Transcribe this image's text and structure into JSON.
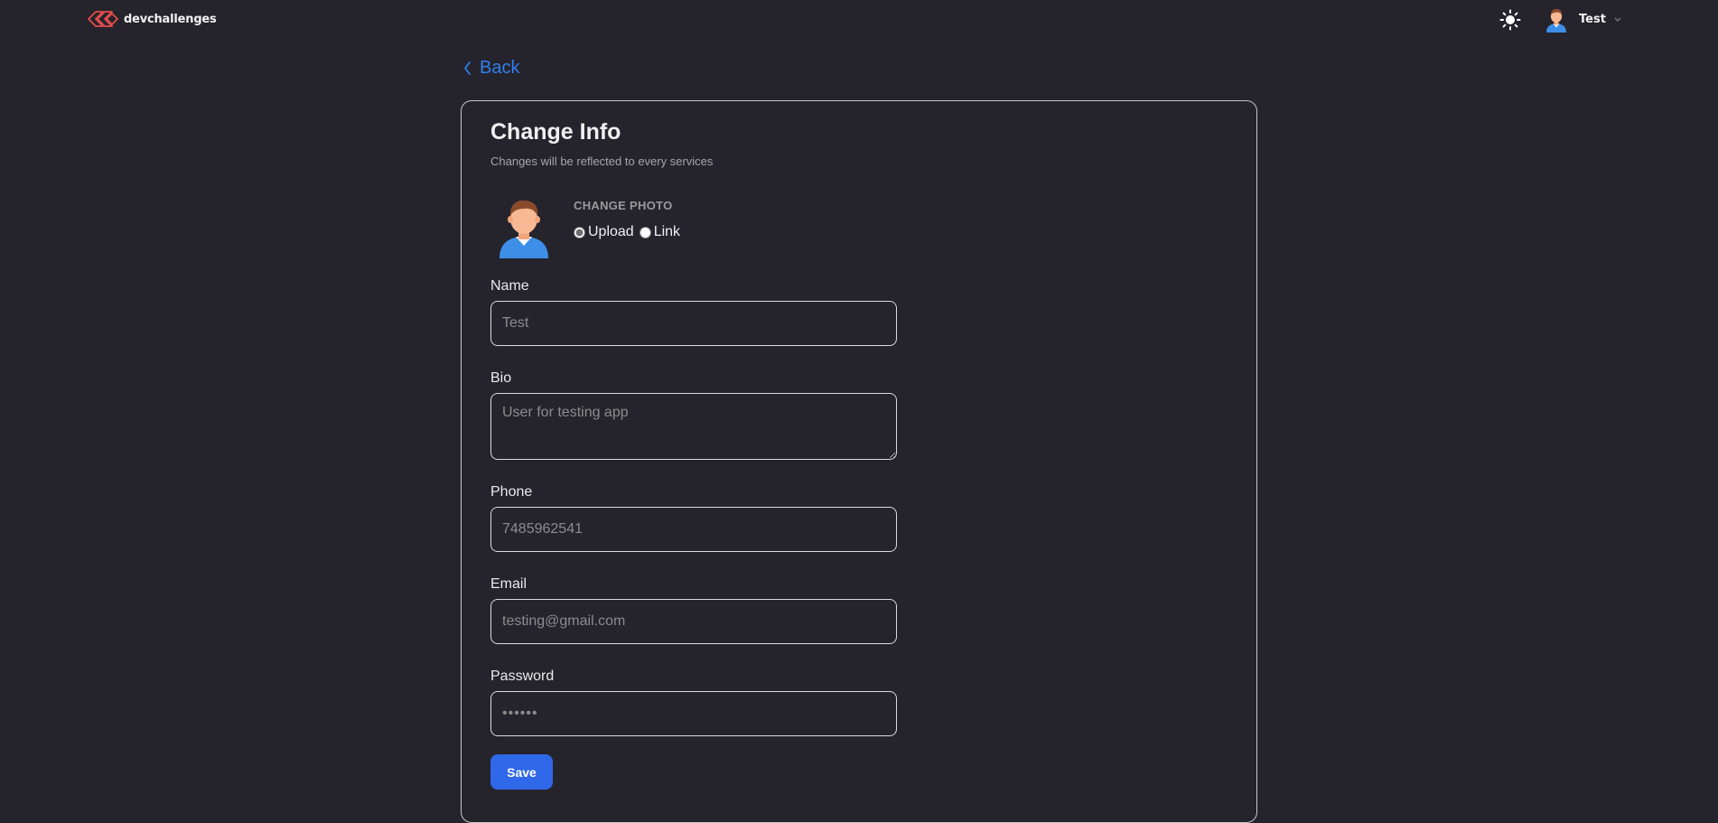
{
  "header": {
    "logo_text": "devchallenges",
    "user_name": "Test",
    "icons": [
      "logo-icon",
      "sun-icon",
      "avatar",
      "chevron-down-icon"
    ]
  },
  "back": {
    "label": "Back"
  },
  "card": {
    "title": "Change Info",
    "subtitle": "Changes will be reflected to every services",
    "photo": {
      "label": "CHANGE PHOTO",
      "options": [
        "Upload",
        "Link"
      ],
      "selected": "Upload"
    },
    "fields": {
      "name": {
        "label": "Name",
        "placeholder": "Test"
      },
      "bio": {
        "label": "Bio",
        "placeholder": "User for testing app"
      },
      "phone": {
        "label": "Phone",
        "placeholder": "7485962541"
      },
      "email": {
        "label": "Email",
        "placeholder": "testing@gmail.com"
      },
      "password": {
        "label": "Password",
        "placeholder": "••••••"
      }
    },
    "save_label": "Save"
  },
  "colors": {
    "background": "#25232c",
    "accent": "#2f80ed",
    "button": "#2f68e8",
    "logo_red": "#e54b4b"
  }
}
